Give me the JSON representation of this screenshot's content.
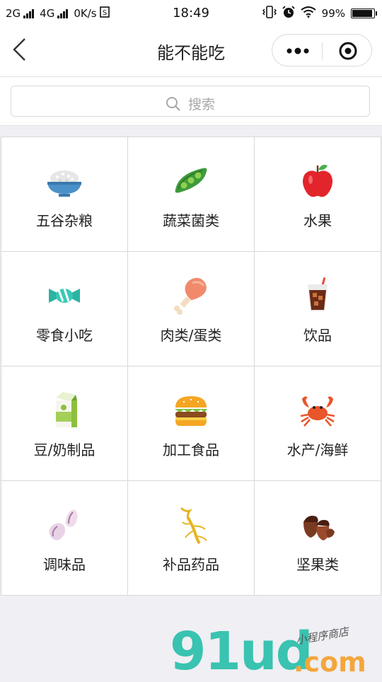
{
  "status_bar": {
    "sim1": "2G",
    "sim2": "4G",
    "speed": "0K/s",
    "time": "18:49",
    "battery": "99%",
    "battery_level": 0.99
  },
  "nav": {
    "title": "能不能吃"
  },
  "search": {
    "placeholder": "搜索"
  },
  "categories": [
    {
      "label": "五谷杂粮",
      "icon": "rice-bowl-icon"
    },
    {
      "label": "蔬菜菌类",
      "icon": "peapod-icon"
    },
    {
      "label": "水果",
      "icon": "apple-icon"
    },
    {
      "label": "零食小吃",
      "icon": "candy-icon"
    },
    {
      "label": "肉类/蛋类",
      "icon": "drumstick-icon"
    },
    {
      "label": "饮品",
      "icon": "drink-icon"
    },
    {
      "label": "豆/奶制品",
      "icon": "milk-carton-icon"
    },
    {
      "label": "加工食品",
      "icon": "burger-icon"
    },
    {
      "label": "水产/海鲜",
      "icon": "crab-icon"
    },
    {
      "label": "调味品",
      "icon": "garlic-icon"
    },
    {
      "label": "补品药品",
      "icon": "ginseng-icon"
    },
    {
      "label": "坚果类",
      "icon": "nuts-icon"
    }
  ],
  "watermark": {
    "brand": "91ud",
    "domain": ".com",
    "tagline": "小程序商店"
  },
  "colors": {
    "watermark_teal": "#39c3b0",
    "watermark_orange": "#f4a63c"
  }
}
